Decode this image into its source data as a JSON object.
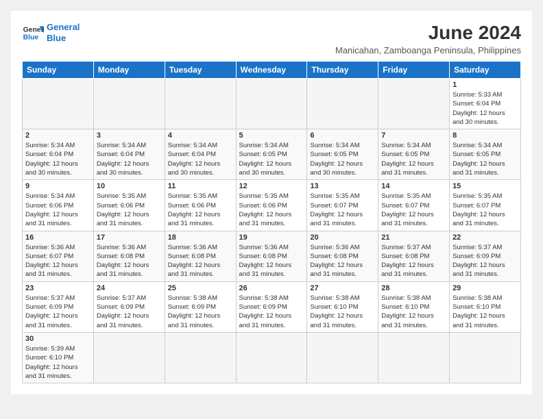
{
  "header": {
    "logo_line1": "General",
    "logo_line2": "Blue",
    "month_title": "June 2024",
    "location": "Manicahan, Zamboanga Peninsula, Philippines"
  },
  "days_of_week": [
    "Sunday",
    "Monday",
    "Tuesday",
    "Wednesday",
    "Thursday",
    "Friday",
    "Saturday"
  ],
  "weeks": [
    [
      {
        "day": "",
        "info": ""
      },
      {
        "day": "",
        "info": ""
      },
      {
        "day": "",
        "info": ""
      },
      {
        "day": "",
        "info": ""
      },
      {
        "day": "",
        "info": ""
      },
      {
        "day": "",
        "info": ""
      },
      {
        "day": "1",
        "info": "Sunrise: 5:33 AM\nSunset: 6:04 PM\nDaylight: 12 hours\nand 30 minutes."
      }
    ],
    [
      {
        "day": "2",
        "info": "Sunrise: 5:34 AM\nSunset: 6:04 PM\nDaylight: 12 hours\nand 30 minutes."
      },
      {
        "day": "3",
        "info": "Sunrise: 5:34 AM\nSunset: 6:04 PM\nDaylight: 12 hours\nand 30 minutes."
      },
      {
        "day": "4",
        "info": "Sunrise: 5:34 AM\nSunset: 6:04 PM\nDaylight: 12 hours\nand 30 minutes."
      },
      {
        "day": "5",
        "info": "Sunrise: 5:34 AM\nSunset: 6:05 PM\nDaylight: 12 hours\nand 30 minutes."
      },
      {
        "day": "6",
        "info": "Sunrise: 5:34 AM\nSunset: 6:05 PM\nDaylight: 12 hours\nand 30 minutes."
      },
      {
        "day": "7",
        "info": "Sunrise: 5:34 AM\nSunset: 6:05 PM\nDaylight: 12 hours\nand 31 minutes."
      },
      {
        "day": "8",
        "info": "Sunrise: 5:34 AM\nSunset: 6:05 PM\nDaylight: 12 hours\nand 31 minutes."
      }
    ],
    [
      {
        "day": "9",
        "info": "Sunrise: 5:34 AM\nSunset: 6:06 PM\nDaylight: 12 hours\nand 31 minutes."
      },
      {
        "day": "10",
        "info": "Sunrise: 5:35 AM\nSunset: 6:06 PM\nDaylight: 12 hours\nand 31 minutes."
      },
      {
        "day": "11",
        "info": "Sunrise: 5:35 AM\nSunset: 6:06 PM\nDaylight: 12 hours\nand 31 minutes."
      },
      {
        "day": "12",
        "info": "Sunrise: 5:35 AM\nSunset: 6:06 PM\nDaylight: 12 hours\nand 31 minutes."
      },
      {
        "day": "13",
        "info": "Sunrise: 5:35 AM\nSunset: 6:07 PM\nDaylight: 12 hours\nand 31 minutes."
      },
      {
        "day": "14",
        "info": "Sunrise: 5:35 AM\nSunset: 6:07 PM\nDaylight: 12 hours\nand 31 minutes."
      },
      {
        "day": "15",
        "info": "Sunrise: 5:35 AM\nSunset: 6:07 PM\nDaylight: 12 hours\nand 31 minutes."
      }
    ],
    [
      {
        "day": "16",
        "info": "Sunrise: 5:36 AM\nSunset: 6:07 PM\nDaylight: 12 hours\nand 31 minutes."
      },
      {
        "day": "17",
        "info": "Sunrise: 5:36 AM\nSunset: 6:08 PM\nDaylight: 12 hours\nand 31 minutes."
      },
      {
        "day": "18",
        "info": "Sunrise: 5:36 AM\nSunset: 6:08 PM\nDaylight: 12 hours\nand 31 minutes."
      },
      {
        "day": "19",
        "info": "Sunrise: 5:36 AM\nSunset: 6:08 PM\nDaylight: 12 hours\nand 31 minutes."
      },
      {
        "day": "20",
        "info": "Sunrise: 5:36 AM\nSunset: 6:08 PM\nDaylight: 12 hours\nand 31 minutes."
      },
      {
        "day": "21",
        "info": "Sunrise: 5:37 AM\nSunset: 6:08 PM\nDaylight: 12 hours\nand 31 minutes."
      },
      {
        "day": "22",
        "info": "Sunrise: 5:37 AM\nSunset: 6:09 PM\nDaylight: 12 hours\nand 31 minutes."
      }
    ],
    [
      {
        "day": "23",
        "info": "Sunrise: 5:37 AM\nSunset: 6:09 PM\nDaylight: 12 hours\nand 31 minutes."
      },
      {
        "day": "24",
        "info": "Sunrise: 5:37 AM\nSunset: 6:09 PM\nDaylight: 12 hours\nand 31 minutes."
      },
      {
        "day": "25",
        "info": "Sunrise: 5:38 AM\nSunset: 6:09 PM\nDaylight: 12 hours\nand 31 minutes."
      },
      {
        "day": "26",
        "info": "Sunrise: 5:38 AM\nSunset: 6:09 PM\nDaylight: 12 hours\nand 31 minutes."
      },
      {
        "day": "27",
        "info": "Sunrise: 5:38 AM\nSunset: 6:10 PM\nDaylight: 12 hours\nand 31 minutes."
      },
      {
        "day": "28",
        "info": "Sunrise: 5:38 AM\nSunset: 6:10 PM\nDaylight: 12 hours\nand 31 minutes."
      },
      {
        "day": "29",
        "info": "Sunrise: 5:38 AM\nSunset: 6:10 PM\nDaylight: 12 hours\nand 31 minutes."
      }
    ],
    [
      {
        "day": "30",
        "info": "Sunrise: 5:39 AM\nSunset: 6:10 PM\nDaylight: 12 hours\nand 31 minutes."
      },
      {
        "day": "",
        "info": ""
      },
      {
        "day": "",
        "info": ""
      },
      {
        "day": "",
        "info": ""
      },
      {
        "day": "",
        "info": ""
      },
      {
        "day": "",
        "info": ""
      },
      {
        "day": "",
        "info": ""
      }
    ]
  ]
}
